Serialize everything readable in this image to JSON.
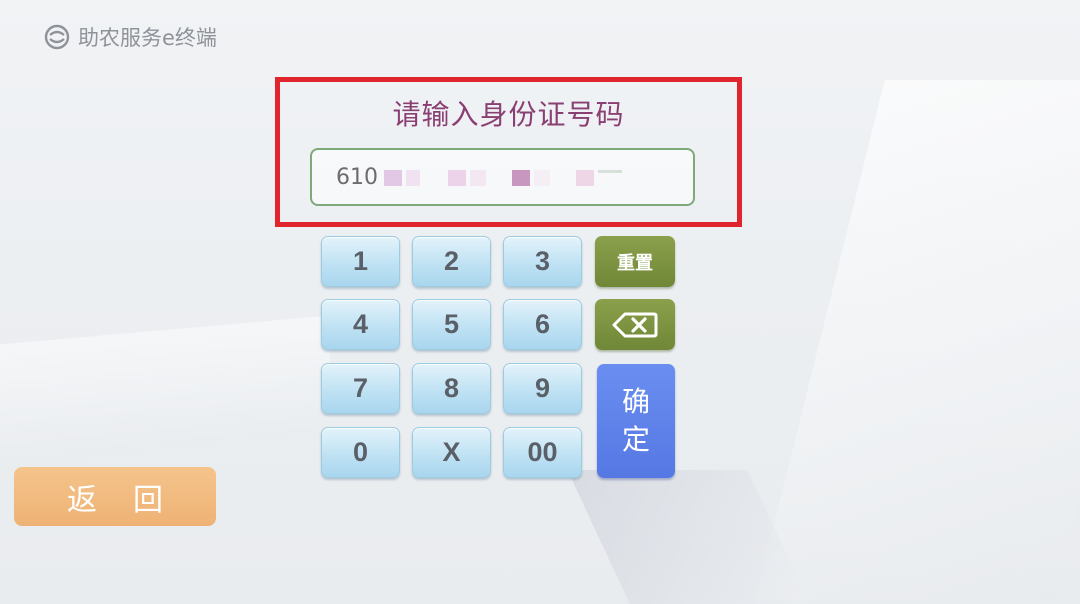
{
  "brand": {
    "name": "助农服务e终端",
    "icon": "service-logo-icon"
  },
  "prompt": "请输入身份证号码",
  "id_input": {
    "value": "610"
  },
  "keypad": {
    "keys": [
      "1",
      "2",
      "3",
      "4",
      "5",
      "6",
      "7",
      "8",
      "9",
      "0",
      "X",
      "00"
    ],
    "reset_label": "重置",
    "backspace_icon": "backspace-icon",
    "confirm_label_line1": "确",
    "confirm_label_line2": "定"
  },
  "back_button": {
    "label": "返回"
  },
  "colors": {
    "highlight_border": "#e0252f",
    "prompt_text": "#8a3f72",
    "input_border": "#7fa97a",
    "key_blue": "#bfe2f3",
    "key_green": "#7b933f",
    "confirm_blue": "#5e82ea",
    "back_orange": "#f0b77a"
  }
}
